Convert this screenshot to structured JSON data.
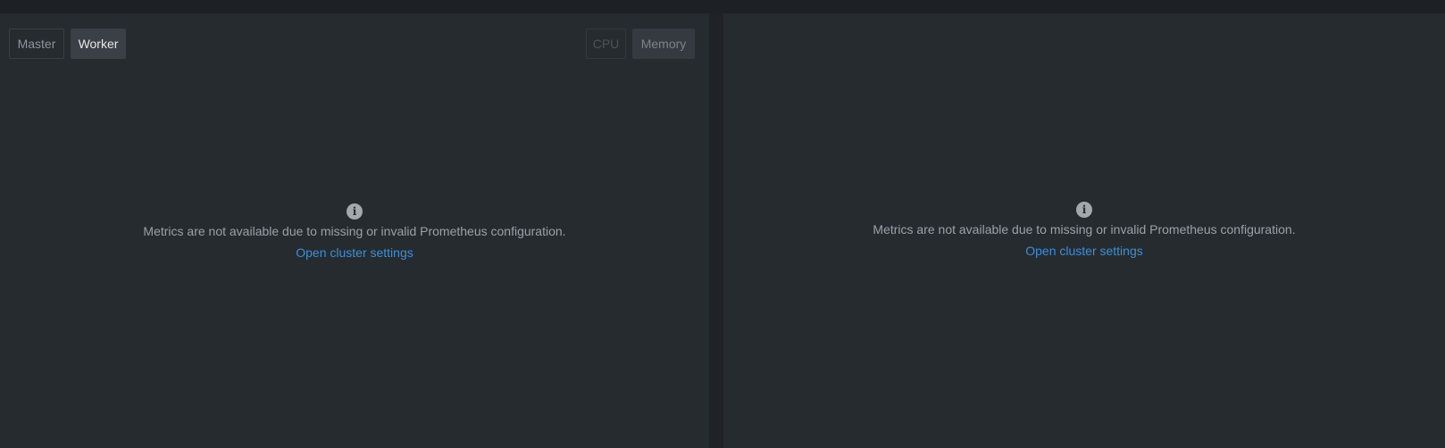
{
  "node_toggle": {
    "master_label": "Master",
    "worker_label": "Worker",
    "selected": "Worker"
  },
  "metric_toggle": {
    "cpu_label": "CPU",
    "memory_label": "Memory",
    "selected": "Memory"
  },
  "left_panel": {
    "empty_message": "Metrics are not available due to missing or invalid Prometheus configuration.",
    "link_label": "Open cluster settings"
  },
  "right_panel": {
    "empty_message": "Metrics are not available due to missing or invalid Prometheus configuration.",
    "link_label": "Open cluster settings"
  },
  "icons": {
    "info": "info-icon"
  },
  "colors": {
    "background": "#262b30",
    "link": "#3d8fd6",
    "text_muted": "#9ba1a7"
  }
}
